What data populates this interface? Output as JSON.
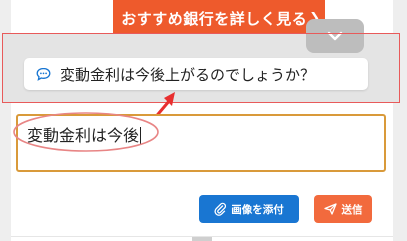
{
  "header": {
    "cta_label": "おすすめ銀行を詳しく見る",
    "cta_chevron": "❯"
  },
  "suggestion": {
    "text": "変動金利は今後上がるのでしょうか？",
    "icon": "chat-bubble-icon"
  },
  "input": {
    "value": "変動金利は今後"
  },
  "actions": {
    "attach_label": "画像を添付",
    "attach_icon": "paperclip-icon",
    "send_label": "送信",
    "send_icon": "paper-plane-icon"
  },
  "colors": {
    "cta": "#ee5a2c",
    "attach_button": "#1976d2",
    "send_button": "#f26a3d",
    "input_border": "#d99a3a",
    "annotation": "#e85a5a"
  }
}
